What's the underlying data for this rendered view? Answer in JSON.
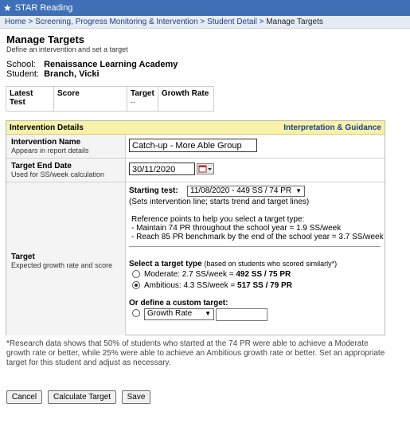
{
  "app": {
    "title": "STAR Reading",
    "logo_icon": "star-icon"
  },
  "breadcrumb": [
    {
      "label": "Home",
      "link": true
    },
    {
      "label": "Screening, Progress Monitoring & Intervention",
      "link": true
    },
    {
      "label": "Student Detail",
      "link": true
    },
    {
      "label": "Manage Targets",
      "link": false
    }
  ],
  "page": {
    "title": "Manage Targets",
    "subtitle": "Define an intervention and set a target"
  },
  "info": {
    "school_label": "School:",
    "school": "Renaissance Learning Academy",
    "student_label": "Student:",
    "student": "Branch, Vicki"
  },
  "test_table": {
    "latest_test": "Latest Test",
    "score": "Score",
    "target": "Target",
    "target_value": "--",
    "growth_rate": "Growth Rate"
  },
  "panel": {
    "title": "Intervention Details",
    "guidance_link": "Interpretation & Guidance",
    "name": {
      "label": "Intervention Name",
      "desc": "Appears in report details",
      "value": "Catch-up - More Able Group"
    },
    "end_date": {
      "label": "Target End Date",
      "desc": "Used for SS/week calculation",
      "value": "30/11/2020"
    },
    "target": {
      "label": "Target",
      "desc": "Expected growth rate and score",
      "starting_label": "Starting test:",
      "starting_value": "11/08/2020 - 449 SS / 74 PR",
      "starting_note": "(Sets intervention line; starts trend and target lines)",
      "ref_intro": "Reference points to help you select a target type:",
      "ref_1": "- Maintain 74 PR throughout the school year = 1.9 SS/week",
      "ref_2": "- Reach 85 PR benchmark by the end of the school year = 3.7 SS/week",
      "select_heading": "Select a target type",
      "select_note": "(based on students who scored similarly*)",
      "options": [
        {
          "label": "Moderate: 2.7 SS/week = ",
          "bold": "492 SS / 75 PR",
          "selected": false
        },
        {
          "label": "Ambitious: 4.3 SS/week = ",
          "bold": "517 SS / 79 PR",
          "selected": true
        }
      ],
      "custom_heading": "Or define a custom target:",
      "custom_select": "Growth Rate",
      "custom_value": ""
    }
  },
  "footnote": "*Research data shows that 50% of students who started at the 74 PR were able to achieve a Moderate growth rate or better, while 25% were able to achieve an Ambitious growth rate or better. Set an appropriate target for this student and adjust as necessary.",
  "buttons": {
    "cancel": "Cancel",
    "calculate": "Calculate Target",
    "save": "Save"
  }
}
